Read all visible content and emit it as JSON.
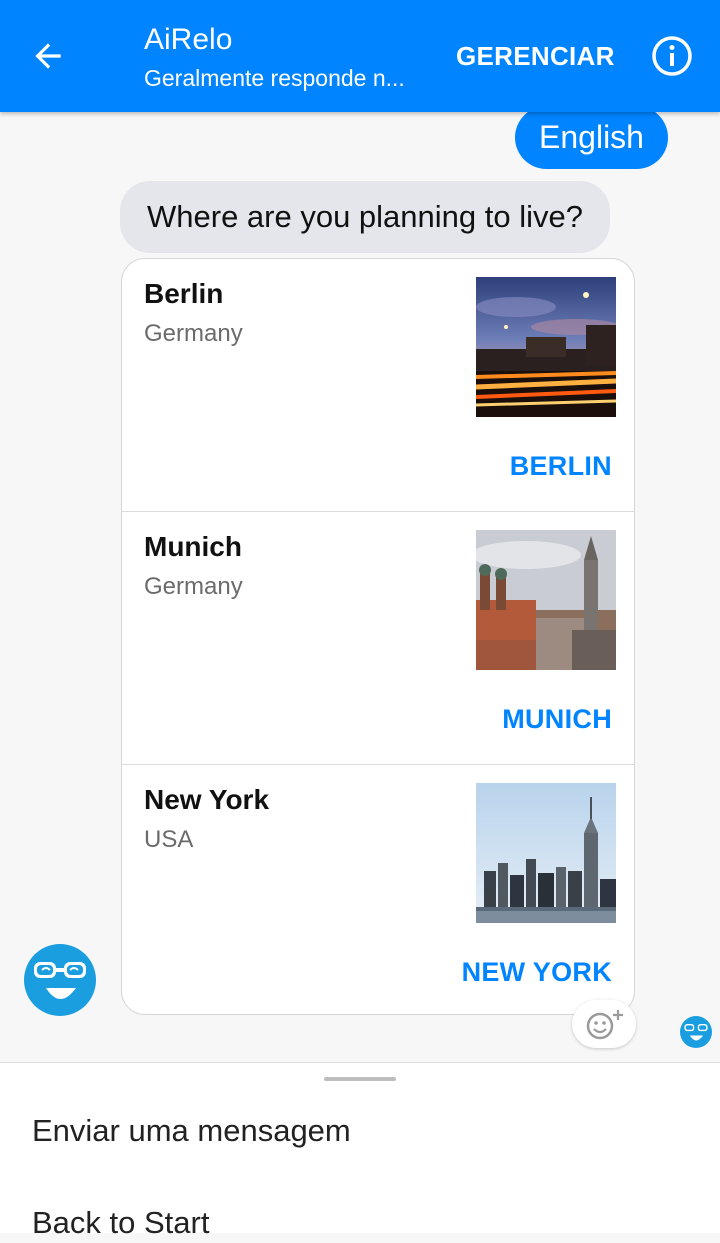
{
  "header": {
    "title": "AiRelo",
    "subtitle": "Geralmente responde n...",
    "manage_label": "GERENCIAR",
    "back_icon": "arrow-left-icon",
    "info_icon": "info-circle-icon",
    "color": "#0084ff"
  },
  "conversation": {
    "user_reply": "English",
    "bot_question": "Where are you planning to live?",
    "cards": [
      {
        "title": "Berlin",
        "subtitle": "Germany",
        "action": "BERLIN",
        "image": "berlin-night-photo"
      },
      {
        "title": "Munich",
        "subtitle": "Germany",
        "action": "MUNICH",
        "image": "munich-skyline-photo"
      },
      {
        "title": "New York",
        "subtitle": "USA",
        "action": "NEW YORK",
        "image": "new-york-skyline-photo"
      }
    ]
  },
  "composer": {
    "items": [
      "Enviar uma mensagem",
      "Back to Start"
    ]
  },
  "colors": {
    "accent": "#0084ff",
    "bot_bubble": "#e4e6eb",
    "avatar": "#1a9ee0"
  }
}
